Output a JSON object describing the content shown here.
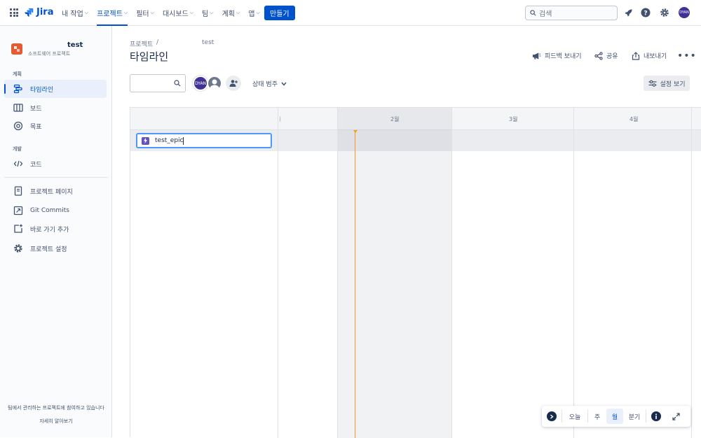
{
  "nav": {
    "logo_text": "Jira",
    "items": [
      {
        "label": "내 작업"
      },
      {
        "label": "프로젝트"
      },
      {
        "label": "필터"
      },
      {
        "label": "대시보드"
      },
      {
        "label": "팀"
      },
      {
        "label": "계획"
      },
      {
        "label": "앱"
      }
    ],
    "create_label": "만들기",
    "search_placeholder": "검색",
    "avatar_initials": "DYAN"
  },
  "sidebar": {
    "project_name": "test",
    "project_type": "소프트웨어 프로젝트",
    "section_planning": "계획",
    "section_dev": "개발",
    "items": [
      {
        "label": "타임라인"
      },
      {
        "label": "보드"
      },
      {
        "label": "목표"
      },
      {
        "label": "코드"
      },
      {
        "label": "프로젝트 페이지"
      },
      {
        "label": "Git Commits"
      },
      {
        "label": "바로 가기 추가"
      },
      {
        "label": "프로젝트 설정"
      }
    ],
    "footer_text": "팀에서 관리하는 프로젝트에 참여하고 있습니다",
    "footer_link": "자세히 알아보기"
  },
  "main": {
    "breadcrumb_root": "프로젝트",
    "breadcrumb_sep": "/",
    "breadcrumb_project": "test",
    "title": "타임라인",
    "actions": {
      "feedback": "피드백 보내기",
      "share": "공유",
      "export": "내보내기"
    },
    "avatar_initials": "DYAN",
    "status_filter": "상태 범주",
    "view_settings": "설정 보기"
  },
  "timeline": {
    "months": [
      "2월",
      "3월",
      "4월"
    ],
    "epic_value": "test_epic",
    "controls": {
      "today": "오늘",
      "week": "주",
      "month": "월",
      "quarter": "분기",
      "selected": "월"
    }
  }
}
